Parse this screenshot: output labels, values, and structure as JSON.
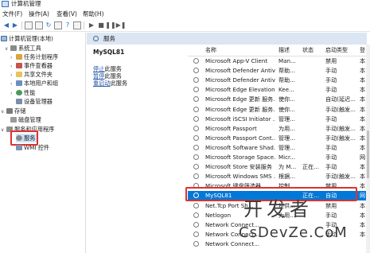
{
  "window": {
    "title": "计算机管理"
  },
  "menu": [
    "文件(F)",
    "操作(A)",
    "查看(V)",
    "帮助(H)"
  ],
  "tree": {
    "root": "计算机管理(本地)",
    "system_tools": "系统工具",
    "task_scheduler": "任务计划程序",
    "event_viewer": "事件查看器",
    "shared_folders": "共享文件夹",
    "local_users": "本地用户和组",
    "performance": "性能",
    "device_manager": "设备管理器",
    "storage": "存储",
    "disk_management": "磁盘管理",
    "services_apps": "服务和应用程序",
    "services": "服务",
    "wmi": "WMI 控件"
  },
  "pane_header": "服务",
  "selected_service": "MySQL81",
  "actions": {
    "stop": "停止",
    "stop_suffix": "此服务",
    "pause": "暂停",
    "pause_suffix": "此服务",
    "restart": "重启动",
    "restart_suffix": "此服务"
  },
  "columns": {
    "name": "名称",
    "description": "描述",
    "status": "状态",
    "startup": "启动类型",
    "logon": "登"
  },
  "services": [
    {
      "name": "Microsoft App-V Client",
      "desc": "Man...",
      "status": "",
      "startup": "禁用",
      "logon": "本"
    },
    {
      "name": "Microsoft Defender Antiv...",
      "desc": "帮助...",
      "status": "",
      "startup": "手动",
      "logon": "本"
    },
    {
      "name": "Microsoft Defender Antiv...",
      "desc": "帮助...",
      "status": "",
      "startup": "手动",
      "logon": "本"
    },
    {
      "name": "Microsoft Edge Elevation...",
      "desc": "Kee...",
      "status": "",
      "startup": "手动",
      "logon": "本"
    },
    {
      "name": "Microsoft Edge 更新 服务...",
      "desc": "使你...",
      "status": "",
      "startup": "自动(延迟...",
      "logon": "本"
    },
    {
      "name": "Microsoft Edge 更新 服务...",
      "desc": "使你...",
      "status": "",
      "startup": "手动(触发...",
      "logon": "本"
    },
    {
      "name": "Microsoft iSCSI Initiator ...",
      "desc": "管理...",
      "status": "",
      "startup": "手动",
      "logon": "本"
    },
    {
      "name": "Microsoft Passport",
      "desc": "为用...",
      "status": "",
      "startup": "手动(触发...",
      "logon": "本"
    },
    {
      "name": "Microsoft Passport Cont...",
      "desc": "管理...",
      "status": "",
      "startup": "手动(触发...",
      "logon": "本"
    },
    {
      "name": "Microsoft Software Shad...",
      "desc": "管理...",
      "status": "",
      "startup": "手动",
      "logon": "本"
    },
    {
      "name": "Microsoft Storage Space...",
      "desc": "Micr...",
      "status": "",
      "startup": "手动",
      "logon": "网"
    },
    {
      "name": "Microsoft Store 安装服务",
      "desc": "为 M...",
      "status": "正在...",
      "startup": "手动",
      "logon": "本"
    },
    {
      "name": "Microsoft Windows SMS ...",
      "desc": "根据...",
      "status": "",
      "startup": "手动(触发...",
      "logon": "本"
    },
    {
      "name": "Microsoft 键盘筛选器",
      "desc": "控制...",
      "status": "",
      "startup": "禁用",
      "logon": "本"
    },
    {
      "name": "MySQL81",
      "desc": "",
      "status": "正在...",
      "startup": "自动",
      "logon": "网"
    },
    {
      "name": "Net.Tcp Port Sh...",
      "desc": "提供...",
      "status": "",
      "startup": "禁用",
      "logon": "本"
    },
    {
      "name": "Netlogon",
      "desc": "为用...",
      "status": "",
      "startup": "手动",
      "logon": "本"
    },
    {
      "name": "Network Connect...",
      "desc": "",
      "status": "",
      "startup": "手动",
      "logon": "本"
    },
    {
      "name": "Network Connect...",
      "desc": "",
      "status": "",
      "startup": "手动",
      "logon": "本"
    },
    {
      "name": "Network Connect...",
      "desc": "",
      "status": "",
      "startup": "",
      "logon": ""
    }
  ],
  "watermark": {
    "line1": "开发者",
    "line2": "CsDevZe.CoM"
  },
  "colors": {
    "selection": "#0078d7",
    "highlight_box": "#e0312e",
    "tree_selected": "#cde3f7",
    "pane_header": "#dbe6f2",
    "link": "#2a5aa8"
  }
}
